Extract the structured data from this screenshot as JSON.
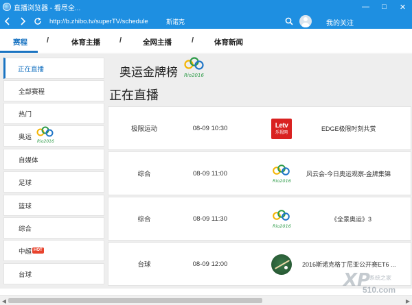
{
  "window": {
    "title": "直播浏览器 - 看尽全...",
    "controls": [
      "—",
      "□",
      "✕"
    ]
  },
  "nav": {
    "url": "http://b.zhibo.tv/superTV/schedule",
    "search_text": "斯诺克",
    "follow_label": "我的关注"
  },
  "tabs": [
    {
      "label": "赛程",
      "active": true
    },
    {
      "label": "体育主播",
      "active": false
    },
    {
      "label": "全网主播",
      "active": false
    },
    {
      "label": "体育新闻",
      "active": false
    }
  ],
  "tab_separator": "/",
  "sidebar": {
    "items": [
      {
        "label": "正在直播",
        "active": true
      },
      {
        "label": "全部赛程"
      },
      {
        "label": "热门"
      },
      {
        "label": "奥运",
        "logo": "rio-2016-logo"
      },
      {
        "label": "自媒体"
      },
      {
        "label": "足球"
      },
      {
        "label": "篮球"
      },
      {
        "label": "综合"
      },
      {
        "label": "中超",
        "badge": "HOT"
      },
      {
        "label": "台球"
      }
    ]
  },
  "main": {
    "medal_title": "奥运金牌榜",
    "logo_text": "Rio2016",
    "live_heading": "正在直播",
    "rows": [
      {
        "category": "极限运动",
        "time": "08-09 10:30",
        "logo": "letv-logo",
        "program": "EDGE极限时刻共赏"
      },
      {
        "category": "综合",
        "time": "08-09 11:00",
        "logo": "rio-2016-logo",
        "program": "风云会-今日奥运观察-金牌集锦"
      },
      {
        "category": "综合",
        "time": "08-09 11:30",
        "logo": "rio-2016-logo",
        "program": "《全景奥运》3"
      },
      {
        "category": "台球",
        "time": "08-09 12:00",
        "logo": "snooker-logo",
        "program": "2016斯诺克格丁尼亚公开赛ET6 ..."
      }
    ]
  },
  "letv_logo": {
    "line1": "Letv",
    "line2": "乐视网"
  },
  "watermark": {
    "text": "XP",
    "sub": "系统之家",
    "num": "510.com"
  },
  "colors": {
    "accent": "#1e8fe1",
    "link_active": "#1a74c2",
    "hot_badge": "#e8432d",
    "letv_red": "#d92221"
  }
}
